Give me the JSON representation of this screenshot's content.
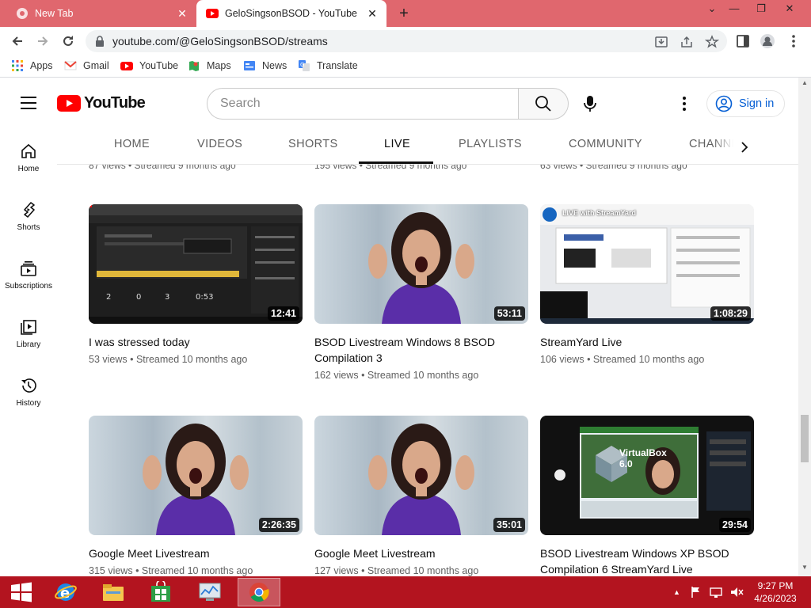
{
  "browser": {
    "tabs": [
      {
        "title": "New Tab",
        "active": false
      },
      {
        "title": "GeloSingsonBSOD - YouTube",
        "active": true
      }
    ],
    "url": "youtube.com/@GeloSingsonBSOD/streams",
    "bookmarks": [
      "Apps",
      "Gmail",
      "YouTube",
      "Maps",
      "News",
      "Translate"
    ]
  },
  "youtube": {
    "logo_text": "YouTube",
    "search_placeholder": "Search",
    "sign_in_label": "Sign in",
    "channel_tabs": [
      "HOME",
      "VIDEOS",
      "SHORTS",
      "LIVE",
      "PLAYLISTS",
      "COMMUNITY",
      "CHANNELS"
    ],
    "active_tab": "LIVE",
    "sidebar": [
      {
        "label": "Home",
        "icon": "home-icon"
      },
      {
        "label": "Shorts",
        "icon": "shorts-icon"
      },
      {
        "label": "Subscriptions",
        "icon": "subscriptions-icon"
      },
      {
        "label": "Library",
        "icon": "library-icon"
      },
      {
        "label": "History",
        "icon": "history-icon"
      }
    ],
    "previous_row_meta": [
      "87 views • Streamed 9 months ago",
      "195 views • Streamed 9 months ago",
      "63 views • Streamed 9 months ago"
    ],
    "videos": [
      {
        "title": "I was stressed today",
        "views": "53 views",
        "streamed": "Streamed 10 months ago",
        "duration": "12:41",
        "thumb": "studio"
      },
      {
        "title": "BSOD Livestream Windows 8 BSOD Compilation 3",
        "views": "162 views",
        "streamed": "Streamed 10 months ago",
        "duration": "53:11",
        "thumb": "girl"
      },
      {
        "title": "StreamYard Live",
        "views": "106 views",
        "streamed": "Streamed 10 months ago",
        "duration": "1:08:29",
        "thumb": "streamyard",
        "thumb_text": "LIVE with StreamYard"
      },
      {
        "title": "Google Meet Livestream",
        "views": "315 views",
        "streamed": "Streamed 10 months ago",
        "duration": "2:26:35",
        "thumb": "girl"
      },
      {
        "title": "Google Meet Livestream",
        "views": "127 views",
        "streamed": "Streamed 10 months ago",
        "duration": "35:01",
        "thumb": "girl"
      },
      {
        "title": "BSOD Livestream Windows XP BSOD Compilation 6 StreamYard Live",
        "views": "",
        "streamed": "",
        "duration": "29:54",
        "thumb": "virtualbox",
        "thumb_text": "VirtualBox 6.0"
      }
    ]
  },
  "taskbar": {
    "time": "9:27 PM",
    "date": "4/26/2023"
  },
  "colors": {
    "tabstrip": "#e0676e",
    "taskbar": "#b3141f",
    "yt_red": "#ff0000",
    "link_blue": "#065fd4"
  }
}
